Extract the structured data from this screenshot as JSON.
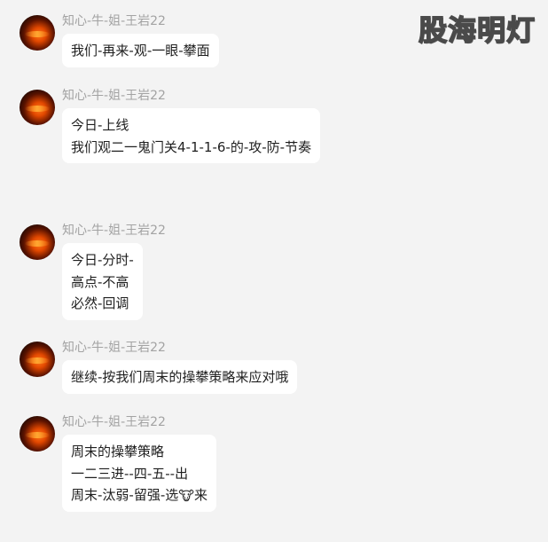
{
  "watermark": "股海明灯",
  "messages": [
    {
      "sender": "知心-牛-姐-王岩22",
      "lines": [
        "我们-再来-观-一眼-攀面"
      ]
    },
    {
      "sender": "知心-牛-姐-王岩22",
      "lines": [
        "今日-上线",
        "我们观二一鬼门关4-1-1-6-的-攻-防-节奏"
      ]
    },
    {
      "sender": "知心-牛-姐-王岩22",
      "lines": [
        "今日-分时-",
        "高点-不高",
        "必然-回调"
      ]
    },
    {
      "sender": "知心-牛-姐-王岩22",
      "lines": [
        "继续-按我们周末的操攀策略来应对哦"
      ]
    },
    {
      "sender": "知心-牛-姐-王岩22",
      "lines": [
        "周末的操攀策略",
        "一二三进--四-五--出"
      ],
      "last_line_before": "周末-汰弱-留强-选",
      "last_line_emoji": "🐮",
      "last_line_after": "来"
    }
  ]
}
